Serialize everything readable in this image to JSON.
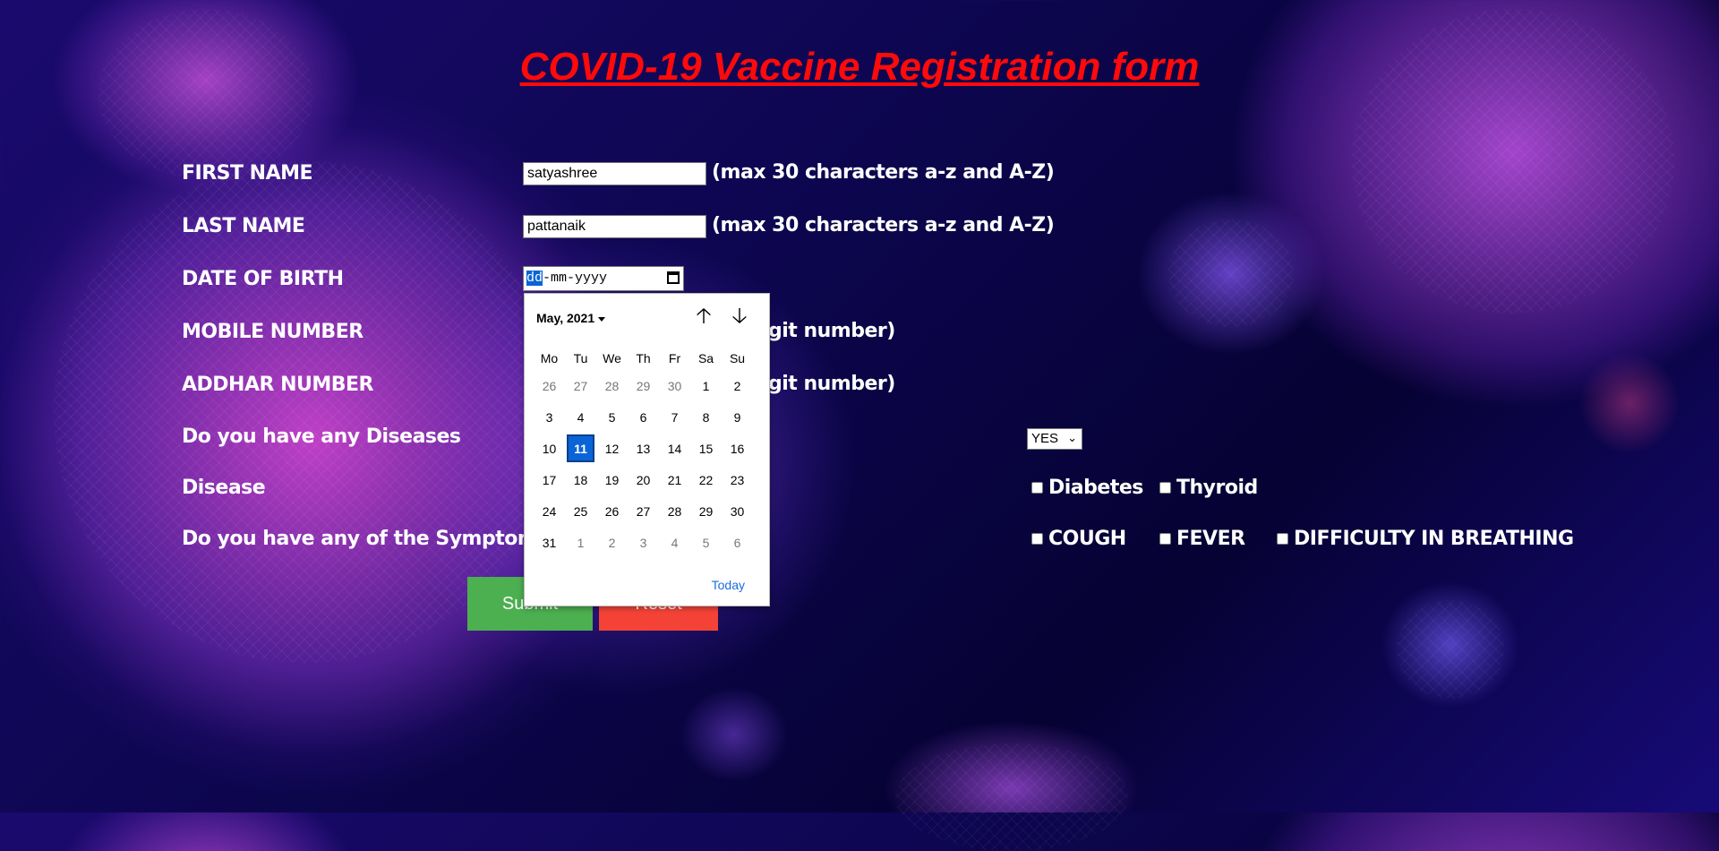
{
  "title": "COVID-19 Vaccine Registration form",
  "form": {
    "first_name_label": "FIRST NAME",
    "first_name_value": "satyashree",
    "first_name_hint": "(max 30 characters a-z and A-Z)",
    "last_name_label": "LAST NAME",
    "last_name_value": "pattanaik",
    "last_name_hint": "(max 30 characters a-z and A-Z)",
    "dob_label": "DATE OF BIRTH",
    "dob_placeholder": {
      "dd": "dd",
      "rest": "-mm-yyyy"
    },
    "mobile_label": "MOBILE NUMBER",
    "mobile_hint_visible": "git number)",
    "addhar_label": "ADDHAR NUMBER",
    "addhar_hint_visible": "git number)",
    "diseases_question": "Do you have any Diseases",
    "diseases_select": "YES",
    "disease_label": "Disease",
    "disease_options": [
      "Diabetes",
      "Thyroid"
    ],
    "symptoms_question": "Do you have any of the Symptoms",
    "symptom_options": [
      "COUGH",
      "FEVER",
      "DIFFICULTY IN BREATHING"
    ],
    "submit_label": "Submit",
    "reset_label": "Reset"
  },
  "datepicker": {
    "month_label": "May, 2021",
    "weekdays": [
      "Mo",
      "Tu",
      "We",
      "Th",
      "Fr",
      "Sa",
      "Su"
    ],
    "days": [
      {
        "d": "26",
        "other": true
      },
      {
        "d": "27",
        "other": true
      },
      {
        "d": "28",
        "other": true
      },
      {
        "d": "29",
        "other": true
      },
      {
        "d": "30",
        "other": true
      },
      {
        "d": "1"
      },
      {
        "d": "2"
      },
      {
        "d": "3"
      },
      {
        "d": "4"
      },
      {
        "d": "5"
      },
      {
        "d": "6"
      },
      {
        "d": "7"
      },
      {
        "d": "8"
      },
      {
        "d": "9"
      },
      {
        "d": "10"
      },
      {
        "d": "11",
        "selected": true
      },
      {
        "d": "12"
      },
      {
        "d": "13"
      },
      {
        "d": "14"
      },
      {
        "d": "15"
      },
      {
        "d": "16"
      },
      {
        "d": "17"
      },
      {
        "d": "18"
      },
      {
        "d": "19"
      },
      {
        "d": "20"
      },
      {
        "d": "21"
      },
      {
        "d": "22"
      },
      {
        "d": "23"
      },
      {
        "d": "24"
      },
      {
        "d": "25"
      },
      {
        "d": "26"
      },
      {
        "d": "27"
      },
      {
        "d": "28"
      },
      {
        "d": "29"
      },
      {
        "d": "30"
      },
      {
        "d": "31"
      },
      {
        "d": "1",
        "other": true
      },
      {
        "d": "2",
        "other": true
      },
      {
        "d": "3",
        "other": true
      },
      {
        "d": "4",
        "other": true
      },
      {
        "d": "5",
        "other": true
      },
      {
        "d": "6",
        "other": true
      }
    ],
    "up_arrow": "🡡",
    "down_arrow": "🡣",
    "today_label": "Today"
  },
  "colors": {
    "title": "#ff0a0a",
    "submit": "#4caf50",
    "reset": "#f44336",
    "selected_day": "#0a64d6"
  },
  "icons": [
    "calendar-icon",
    "arrow-up-icon",
    "arrow-down-icon",
    "chevron-down-icon"
  ]
}
